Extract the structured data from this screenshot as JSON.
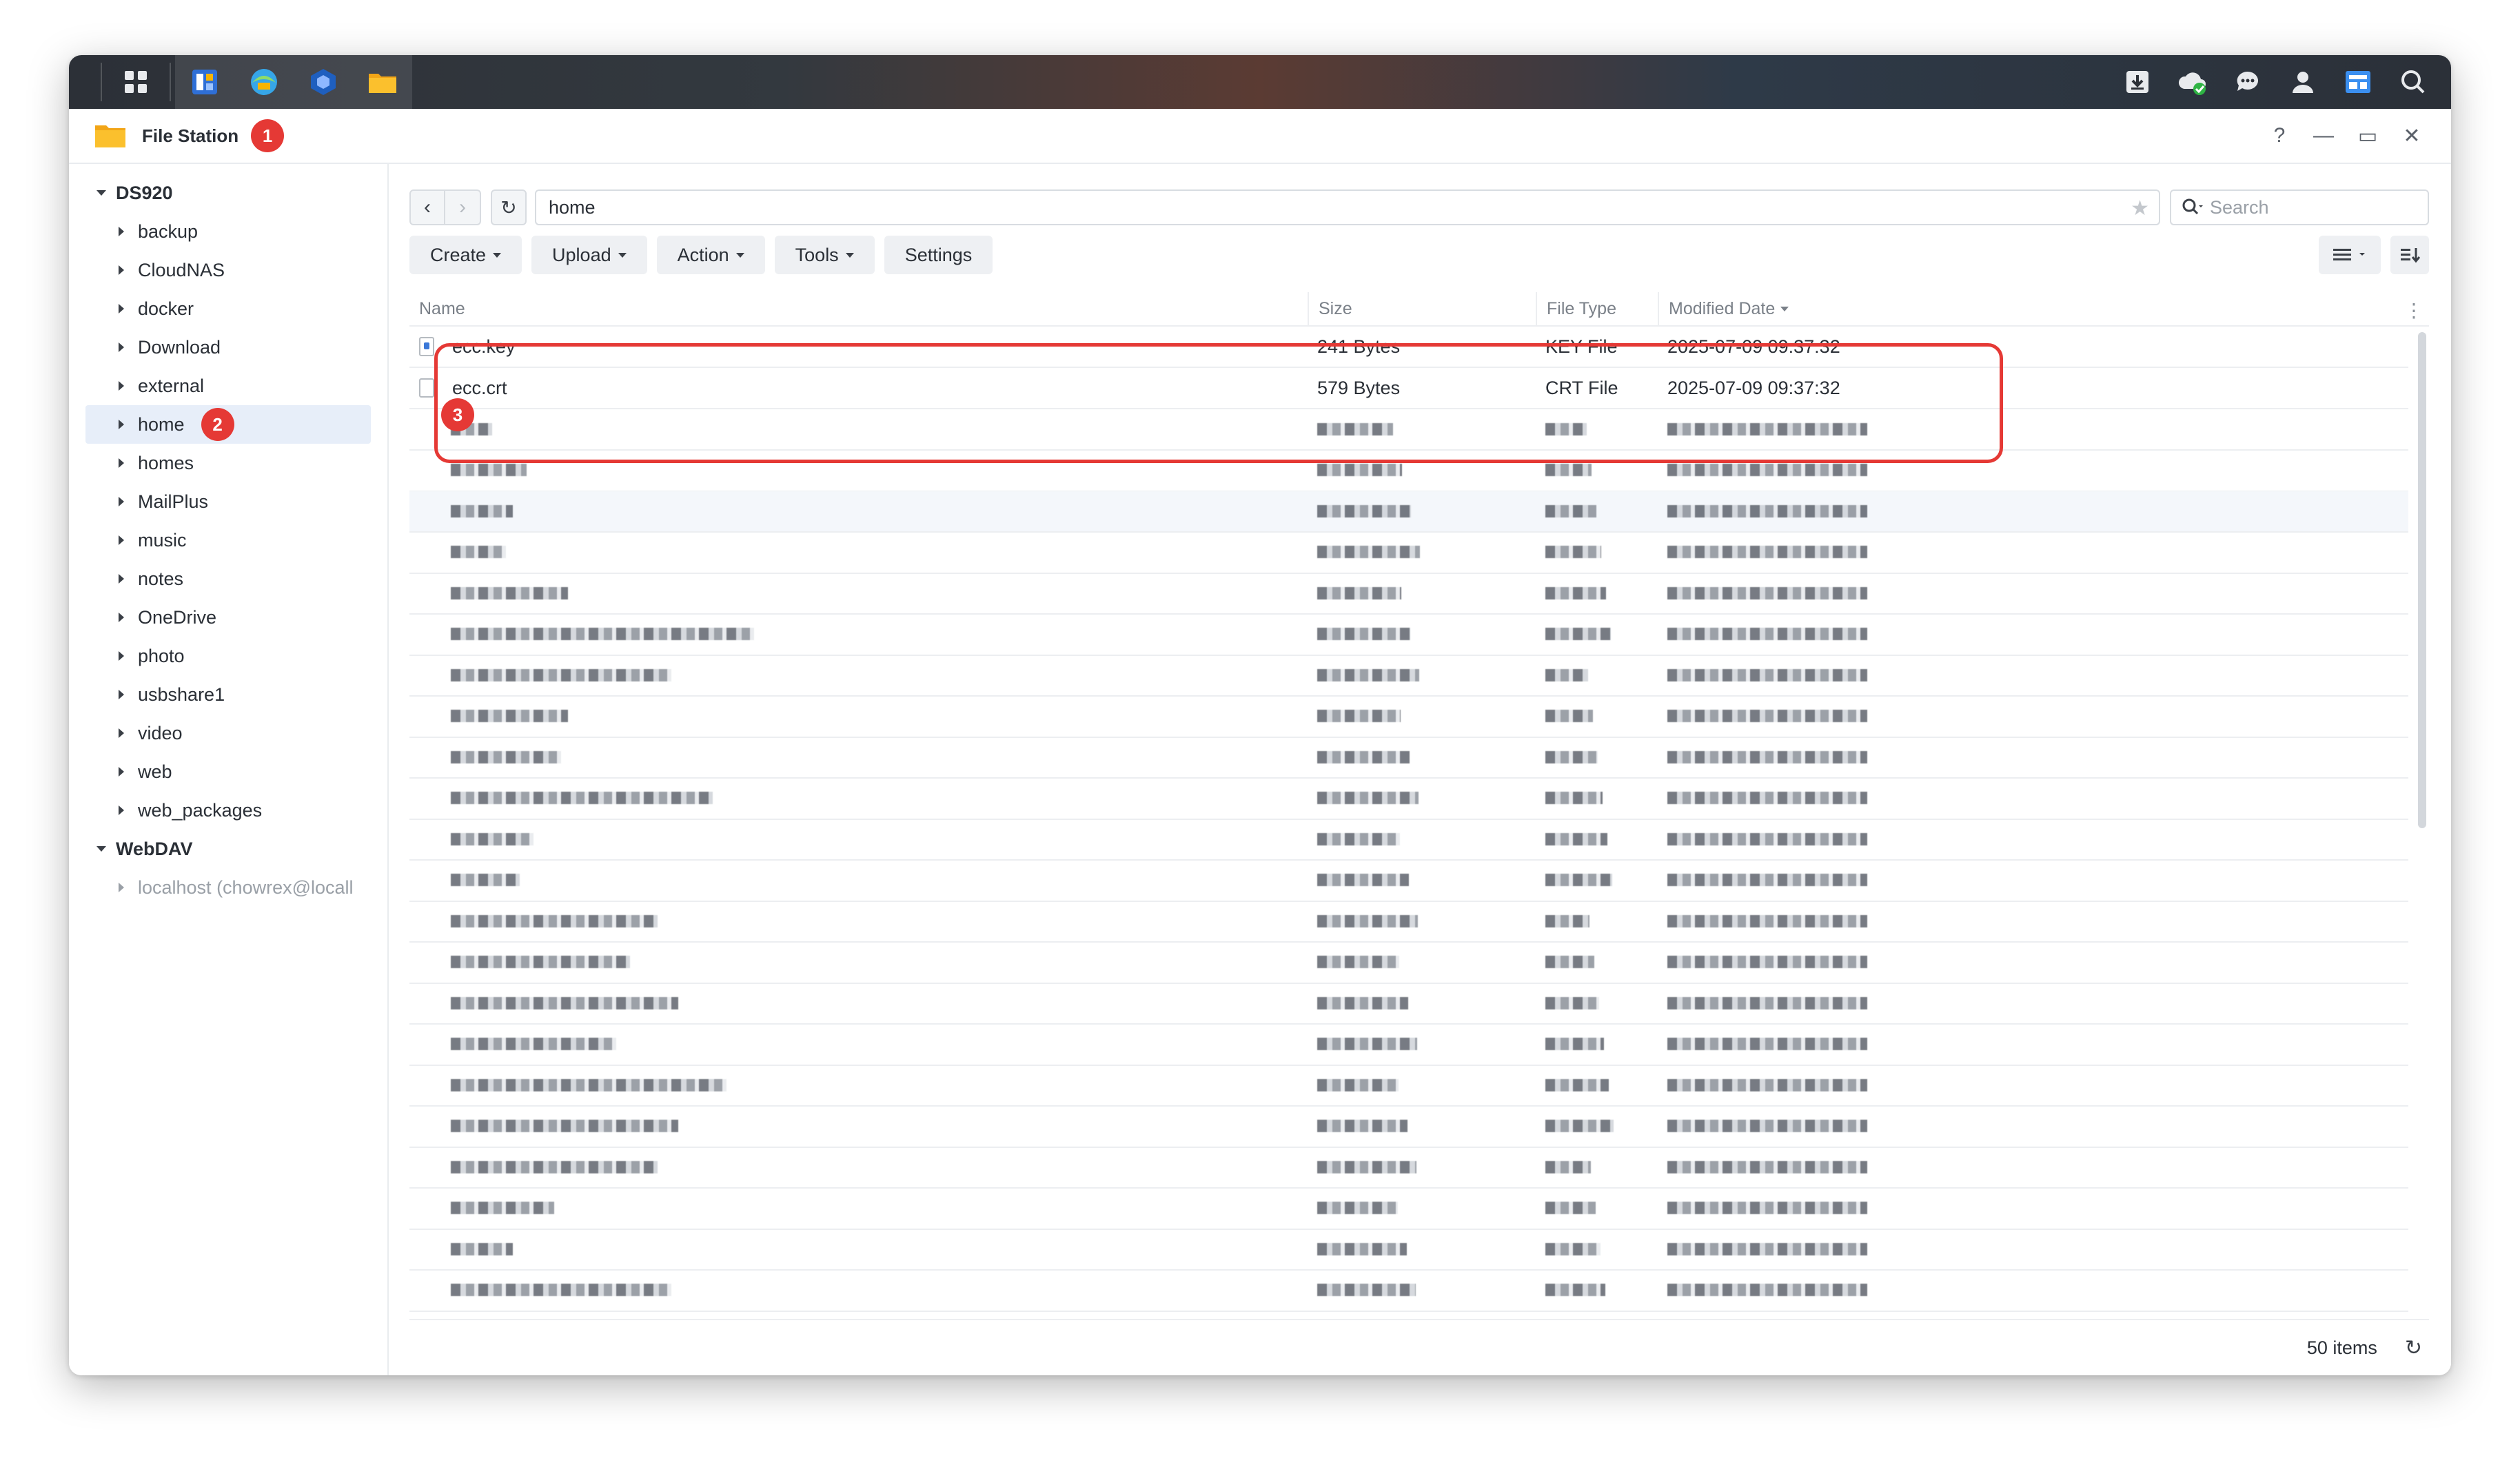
{
  "taskbar": {
    "left_icons": [
      "main-menu-icon",
      "package-center-icon",
      "browser-icon",
      "hyper-backup-icon",
      "file-station-icon"
    ],
    "right_icons": [
      "download-icon",
      "cloud-sync-icon",
      "chat-icon",
      "user-icon",
      "widgets-icon",
      "search-icon"
    ]
  },
  "window": {
    "title": "File Station",
    "badge1": "1",
    "controls": [
      "?",
      "—",
      "▭",
      "✕"
    ]
  },
  "sidebar": {
    "root1": "DS920",
    "items": [
      "backup",
      "CloudNAS",
      "docker",
      "Download",
      "external",
      "home",
      "homes",
      "MailPlus",
      "music",
      "notes",
      "OneDrive",
      "photo",
      "usbshare1",
      "video",
      "web",
      "web_packages"
    ],
    "selected": "home",
    "badge2": "2",
    "root2": "WebDAV",
    "webdav_item": "localhost (chowrex@locall"
  },
  "path": {
    "value": "home",
    "search_placeholder": "Search"
  },
  "toolbar": {
    "create": "Create",
    "upload": "Upload",
    "action": "Action",
    "tools": "Tools",
    "settings": "Settings"
  },
  "table": {
    "headers": {
      "name": "Name",
      "size": "Size",
      "type": "File Type",
      "date": "Modified Date"
    },
    "rows": [
      {
        "name": "ecc.key",
        "size": "241 Bytes",
        "type": "KEY File",
        "date": "2025-07-09 09:37:32"
      },
      {
        "name": "ecc.crt",
        "size": "579 Bytes",
        "type": "CRT File",
        "date": "2025-07-09 09:37:32"
      }
    ],
    "badge3": "3"
  },
  "footer": {
    "count": "50 items"
  },
  "colors": {
    "accent": "#3b78d8",
    "highlight": "#e53935",
    "selected_bg": "#e7eef9"
  }
}
